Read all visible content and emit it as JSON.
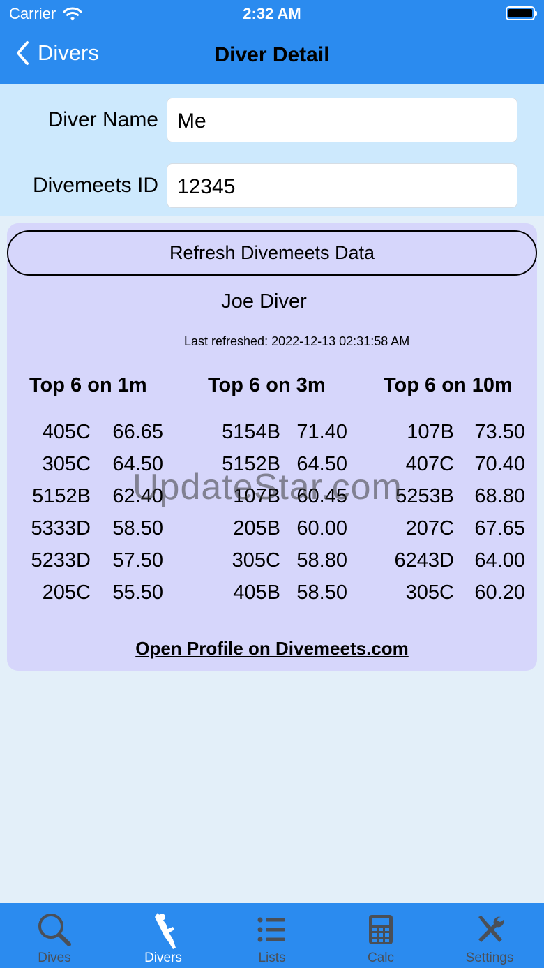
{
  "status_bar": {
    "carrier": "Carrier",
    "time": "2:32 AM"
  },
  "nav": {
    "back_label": "Divers",
    "title": "Diver Detail"
  },
  "form": {
    "diver_name_label": "Diver Name",
    "diver_name_value": "Me",
    "divemeets_id_label": "Divemeets ID",
    "divemeets_id_value": "12345"
  },
  "card": {
    "refresh_label": "Refresh Divemeets Data",
    "diver_full_name": "Joe Diver",
    "last_refreshed": "Last refreshed: 2022-12-13 02:31:58 AM",
    "columns": [
      {
        "title": "Top 6 on 1m",
        "entries": [
          {
            "dive": "405C",
            "score": "66.65"
          },
          {
            "dive": "305C",
            "score": "64.50"
          },
          {
            "dive": "5152B",
            "score": "62.40"
          },
          {
            "dive": "5333D",
            "score": "58.50"
          },
          {
            "dive": "5233D",
            "score": "57.50"
          },
          {
            "dive": "205C",
            "score": "55.50"
          }
        ]
      },
      {
        "title": "Top 6 on 3m",
        "entries": [
          {
            "dive": "5154B",
            "score": "71.40"
          },
          {
            "dive": "5152B",
            "score": "64.50"
          },
          {
            "dive": "107B",
            "score": "60.45"
          },
          {
            "dive": "205B",
            "score": "60.00"
          },
          {
            "dive": "305C",
            "score": "58.80"
          },
          {
            "dive": "405B",
            "score": "58.50"
          }
        ]
      },
      {
        "title": "Top 6 on 10m",
        "entries": [
          {
            "dive": "107B",
            "score": "73.50"
          },
          {
            "dive": "407C",
            "score": "70.40"
          },
          {
            "dive": "5253B",
            "score": "68.80"
          },
          {
            "dive": "207C",
            "score": "67.65"
          },
          {
            "dive": "6243D",
            "score": "64.00"
          },
          {
            "dive": "305C",
            "score": "60.20"
          }
        ]
      }
    ],
    "profile_link": "Open Profile on Divemeets.com"
  },
  "watermark": "UpdateStar.com",
  "tabs": [
    {
      "label": "Dives",
      "icon": "search-icon"
    },
    {
      "label": "Divers",
      "icon": "diver-icon",
      "active": true
    },
    {
      "label": "Lists",
      "icon": "list-icon"
    },
    {
      "label": "Calc",
      "icon": "calculator-icon"
    },
    {
      "label": "Settings",
      "icon": "tools-icon"
    }
  ],
  "colors": {
    "accent": "#2b8bef",
    "form_bg": "#cde9fd",
    "card_bg": "#d6d6fb",
    "page_bg": "#e3eff9"
  }
}
